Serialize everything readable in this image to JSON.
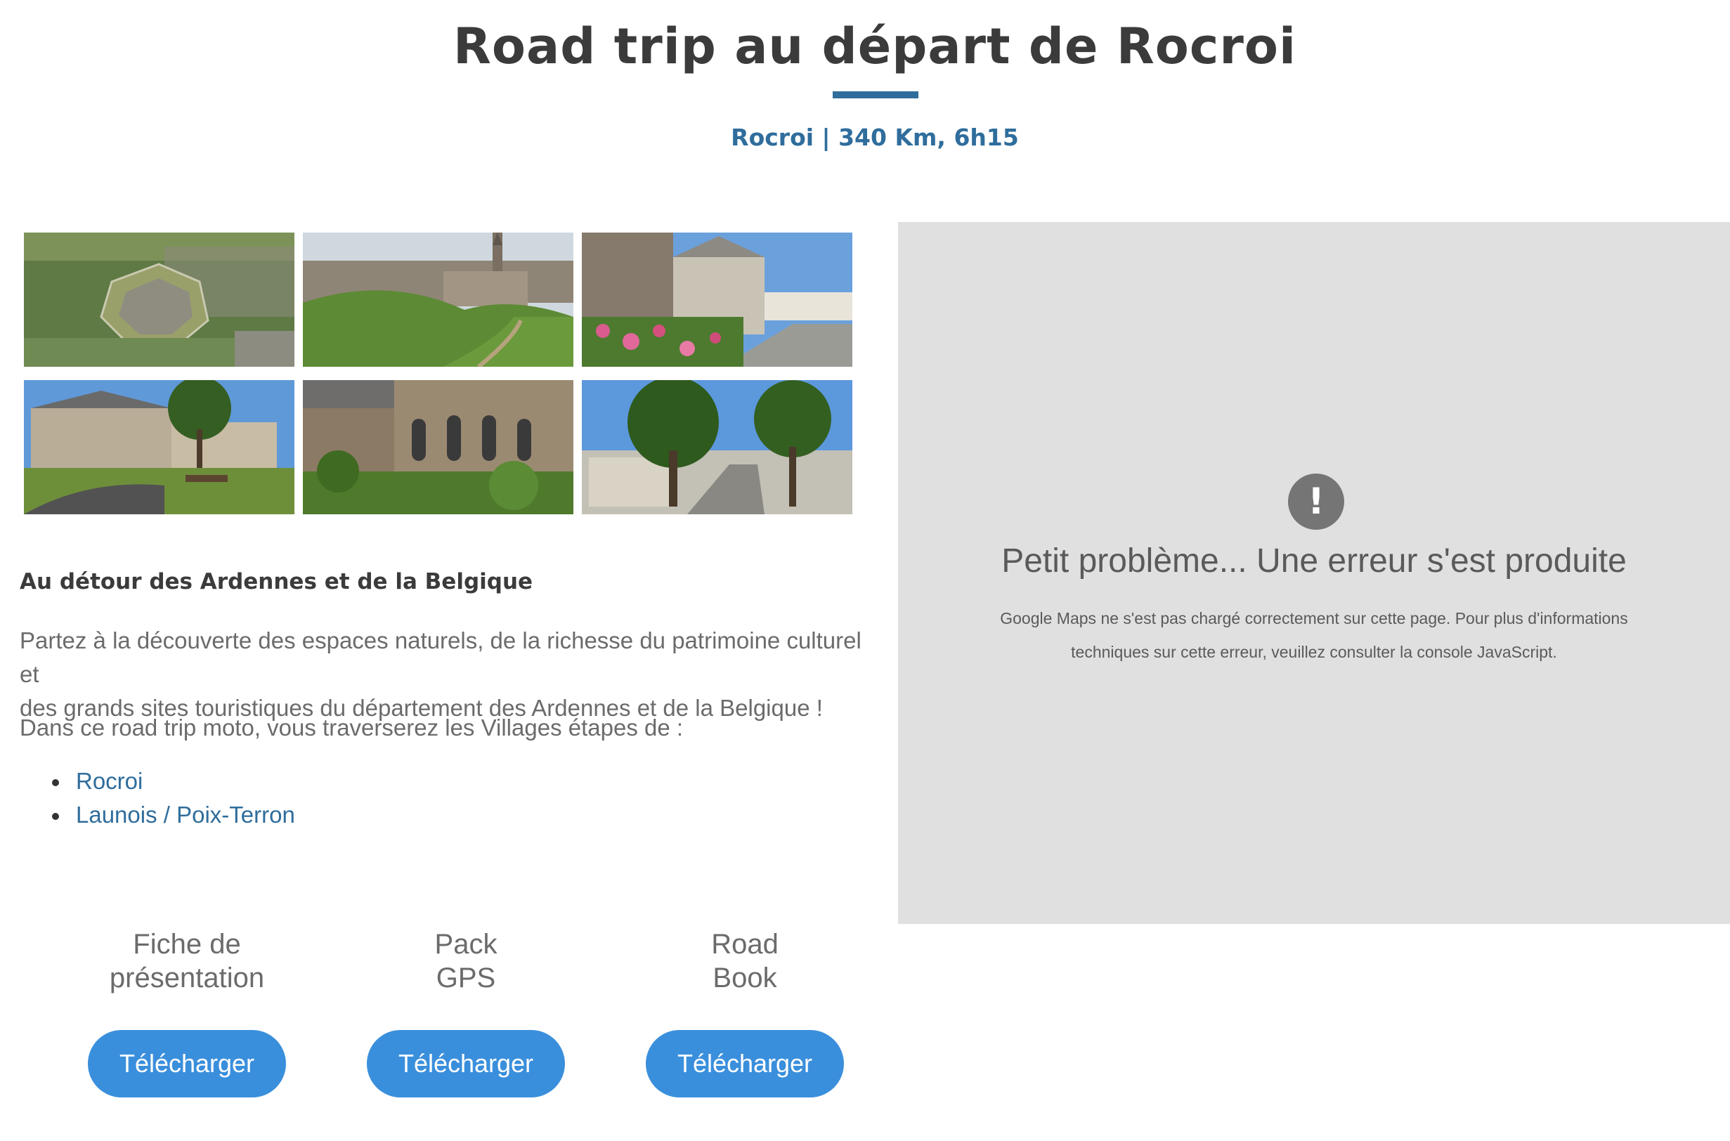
{
  "header": {
    "title": "Road trip au départ de Rocroi",
    "subtitle": "Rocroi | 340 Km, 6h15"
  },
  "gallery": {
    "photos": [
      {
        "icon": "aerial-fortress-photo"
      },
      {
        "icon": "village-ramparts-photo"
      },
      {
        "icon": "church-street-flowers-photo"
      },
      {
        "icon": "old-house-bench-photo"
      },
      {
        "icon": "stone-church-apse-photo"
      },
      {
        "icon": "village-road-trees-photo"
      }
    ]
  },
  "description": {
    "heading": "Au détour des Ardennes et de la Belgique",
    "paragraph_line1": "Partez à la découverte des espaces naturels, de la richesse du patrimoine culturel et",
    "paragraph_line2": "des grands sites touristiques du département des Ardennes et de la Belgique !",
    "villages_intro": "Dans ce road trip moto, vous traverserez les Villages étapes de :",
    "villages": [
      "Rocroi",
      "Launois / Poix-Terron"
    ]
  },
  "downloads": [
    {
      "line1": "Fiche de",
      "line2": "présentation",
      "button": "Télécharger"
    },
    {
      "line1": "Pack",
      "line2": "GPS",
      "button": "Télécharger"
    },
    {
      "line1": "Road",
      "line2": "Book",
      "button": "Télécharger"
    }
  ],
  "map": {
    "error_icon": "!",
    "error_title": "Petit problème... Une erreur s'est produite",
    "error_line1": "Google Maps ne s'est pas chargé correctement sur cette page. Pour plus d'informations",
    "error_line2": "techniques sur cette erreur, veuillez consulter la console JavaScript."
  },
  "colors": {
    "accent": "#2f6d9c",
    "button": "#3a8fdc",
    "map_background": "#e0e0e0"
  }
}
